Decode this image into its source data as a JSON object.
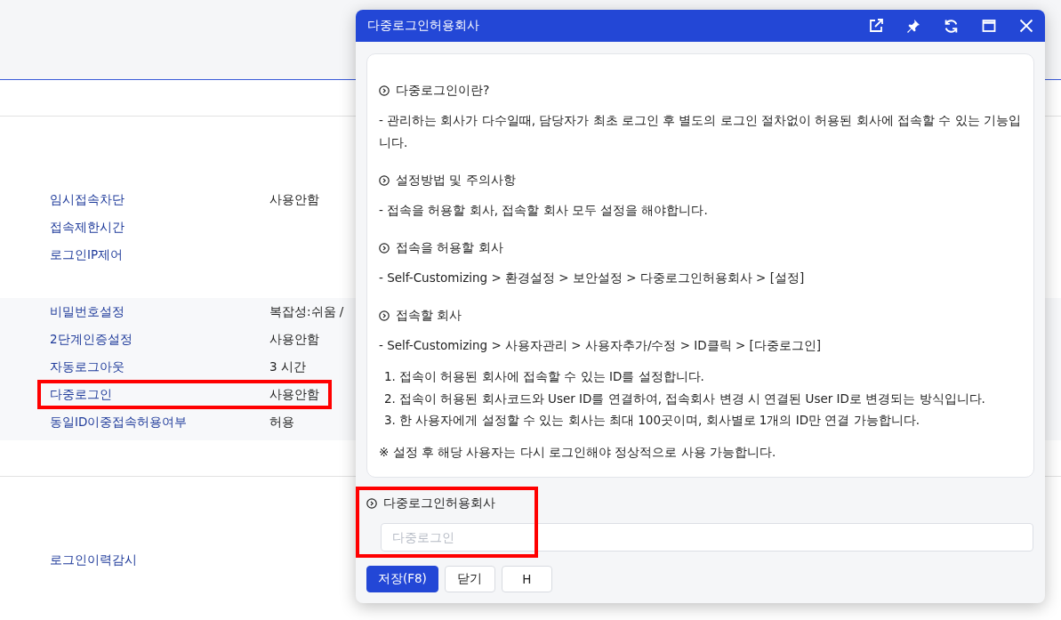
{
  "sections": [
    {
      "rows": [
        {
          "label": "임시접속차단",
          "value": "사용안함",
          "highlighted": false
        },
        {
          "label": "접속제한시간",
          "highlighted": false
        },
        {
          "label": "로그인IP제어",
          "highlighted": false
        }
      ]
    },
    {
      "rows": [
        {
          "label": "비밀번호설정",
          "value": "복잡성:쉬움 /",
          "highlighted": false
        },
        {
          "label": "2단계인증설정",
          "value": "사용안함",
          "highlighted": false
        },
        {
          "label": "자동로그아웃",
          "value": "3 시간",
          "highlighted": false
        },
        {
          "label": "다중로그인",
          "value": "사용안함",
          "highlighted": true
        },
        {
          "label": "동일ID이중접속허용여부",
          "value": "허용",
          "highlighted": false
        }
      ]
    },
    {
      "rows": [
        {
          "label": "로그인이력감시",
          "highlighted": false
        }
      ]
    }
  ],
  "dialog": {
    "title": "다중로그인허용회사",
    "content": [
      {
        "kind": "heading",
        "text": "다중로그인이란?"
      },
      {
        "kind": "paragraph",
        "text": "- 관리하는 회사가 다수일때, 담당자가 최초 로그인 후 별도의 로그인 절차없이 허용된 회사에 접속할 수 있는 기능입니다."
      },
      {
        "kind": "heading",
        "text": "설정방법 및 주의사항"
      },
      {
        "kind": "paragraph",
        "text": "- 접속을 허용할 회사, 접속할 회사 모두 설정을 해야합니다."
      },
      {
        "kind": "heading",
        "text": "접속을 허용할 회사"
      },
      {
        "kind": "paragraph",
        "text": "- Self-Customizing > 환경설정 > 보안설정 > 다중로그인허용회사 > [설정]"
      },
      {
        "kind": "heading",
        "text": "접속할 회사"
      },
      {
        "kind": "paragraph",
        "text": "- Self-Customizing > 사용자관리 > 사용자추가/수정 > ID클릭 > [다중로그인]"
      },
      {
        "kind": "list",
        "items": [
          "1. 접속이 허용된 회사에 접속할 수 있는 ID를 설정합니다.",
          "2. 접속이 허용된 회사코드와 User ID를 연결하여, 접속회사 변경 시 연결된 User ID로 변경되는 방식입니다.",
          "3. 한 사용자에게 설정할 수 있는 회사는 최대 100곳이며, 회사별로 1개의 ID만 연결 가능합니다."
        ]
      },
      {
        "kind": "note",
        "text": "※ 설정 후 해당 사용자는 다시 로그인해야 정상적으로 사용 가능합니다."
      }
    ],
    "field": {
      "label": "다중로그인허용회사",
      "placeholder": "다중로그인",
      "highlighted": true
    },
    "buttons": [
      {
        "label": "저장(F8)",
        "primary": true
      },
      {
        "label": "닫기",
        "primary": false
      },
      {
        "label": "H",
        "primary": false
      }
    ]
  }
}
